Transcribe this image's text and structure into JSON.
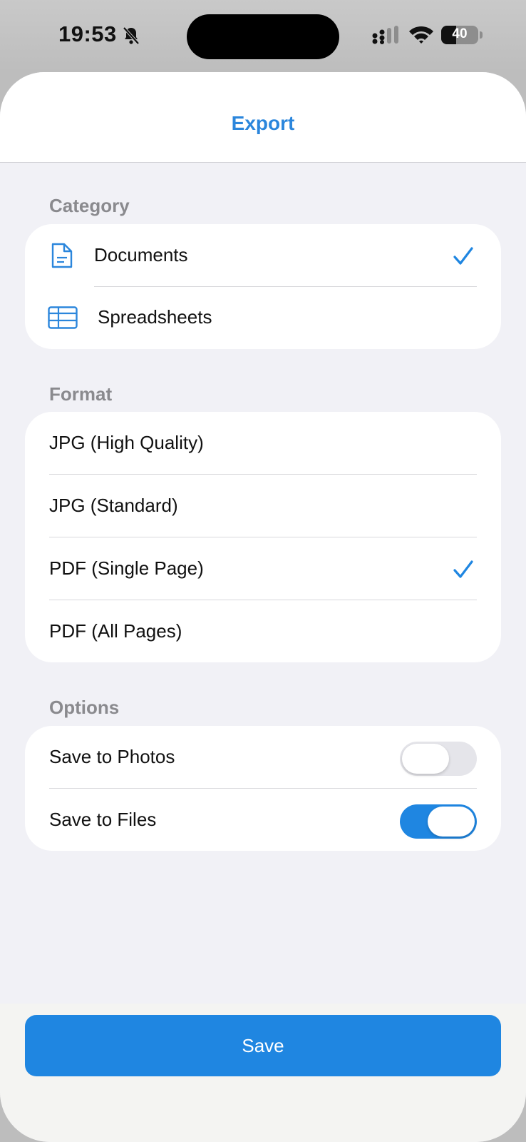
{
  "status_bar": {
    "time": "19:53",
    "battery_percent": "40",
    "battery_level": 0.4
  },
  "sheet": {
    "title": "Export"
  },
  "category": {
    "label": "Category",
    "items": [
      {
        "label": "Documents",
        "icon": "document-icon",
        "selected": true
      },
      {
        "label": "Spreadsheets",
        "icon": "table-icon",
        "selected": false
      }
    ]
  },
  "format": {
    "label": "Format",
    "items": [
      {
        "label": "JPG (High Quality)",
        "selected": false
      },
      {
        "label": "JPG (Standard)",
        "selected": false
      },
      {
        "label": "PDF (Single Page)",
        "selected": true
      },
      {
        "label": "PDF (All Pages)",
        "selected": false
      }
    ]
  },
  "options": {
    "label": "Options",
    "items": [
      {
        "label": "Save to Photos",
        "enabled": false
      },
      {
        "label": "Save to Files",
        "enabled": true
      }
    ]
  },
  "footer": {
    "save_label": "Save"
  },
  "colors": {
    "accent": "#1f86e1",
    "title": "#2b86dc",
    "section_label": "#8a8a8e",
    "background": "#f1f1f6"
  }
}
